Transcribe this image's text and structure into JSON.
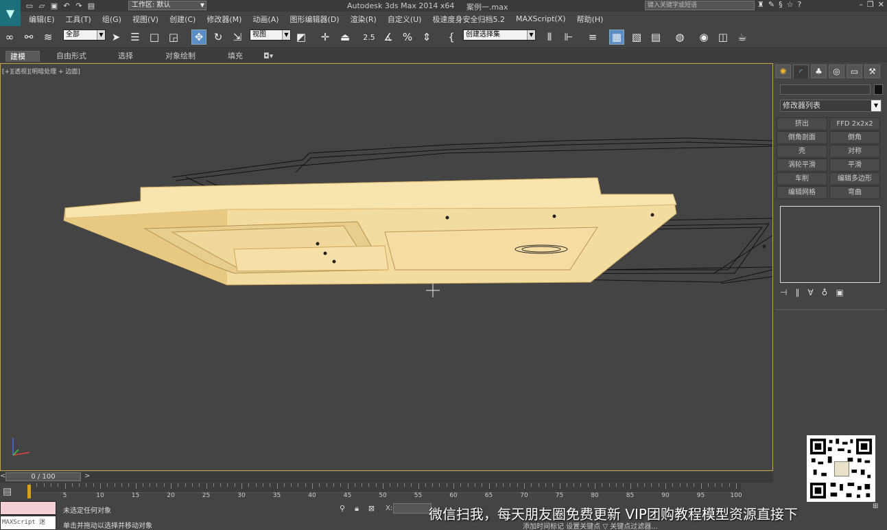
{
  "title": {
    "app": "Autodesk 3ds Max  2014 x64",
    "file": "案例一.max",
    "workspace_label": "工作区: 默认",
    "search_placeholder": "键入关键字或短语"
  },
  "menu": [
    "编辑(E)",
    "工具(T)",
    "组(G)",
    "视图(V)",
    "创建(C)",
    "修改器(M)",
    "动画(A)",
    "图形编辑器(D)",
    "渲染(R)",
    "自定义(U)",
    "极速度身安全归档5.2",
    "MAXScript(X)",
    "帮助(H)"
  ],
  "toolbar": {
    "selection_filter": "全部",
    "ref_coord": "视图",
    "named_selection": "创建选择集",
    "snap_angle_label": "2.5",
    "percent_snap_label": "%"
  },
  "ribbon": {
    "tabs": [
      "建模",
      "自由形式",
      "选择",
      "对象绘制",
      "填充"
    ],
    "active_tab": "建模"
  },
  "viewport": {
    "label": "[+][透视][明暗处理 + 边面]",
    "model_color": "#f3dca0",
    "border_color": "#c7a440"
  },
  "command_panel": {
    "modifier_list": "修改器列表",
    "modifier_buttons": [
      "挤出",
      "FFD 2x2x2",
      "倒角剖面",
      "倒角",
      "壳",
      "对称",
      "涡轮平滑",
      "平滑",
      "车削",
      "编辑多边形",
      "编辑网格",
      "弯曲"
    ]
  },
  "timeline": {
    "frame_display": "0 / 100",
    "prev": "<",
    "next": ">",
    "ticks": [
      5,
      10,
      15,
      20,
      25,
      30,
      35,
      40,
      45,
      50,
      55,
      60,
      65,
      70,
      75,
      80,
      85,
      90,
      95,
      100
    ]
  },
  "status": {
    "maxscript_label": "MAXScript 迷",
    "line1": "未选定任何对象",
    "line2": "单击并拖动以选择并移动对象",
    "x_label": "X:",
    "row2_text": "添加时间标记        设置关键点  ▽ 关键点过滤器..."
  },
  "watermark": "微信扫我，每天朋友圈免费更新 VIP团购教程模型资源直接下"
}
